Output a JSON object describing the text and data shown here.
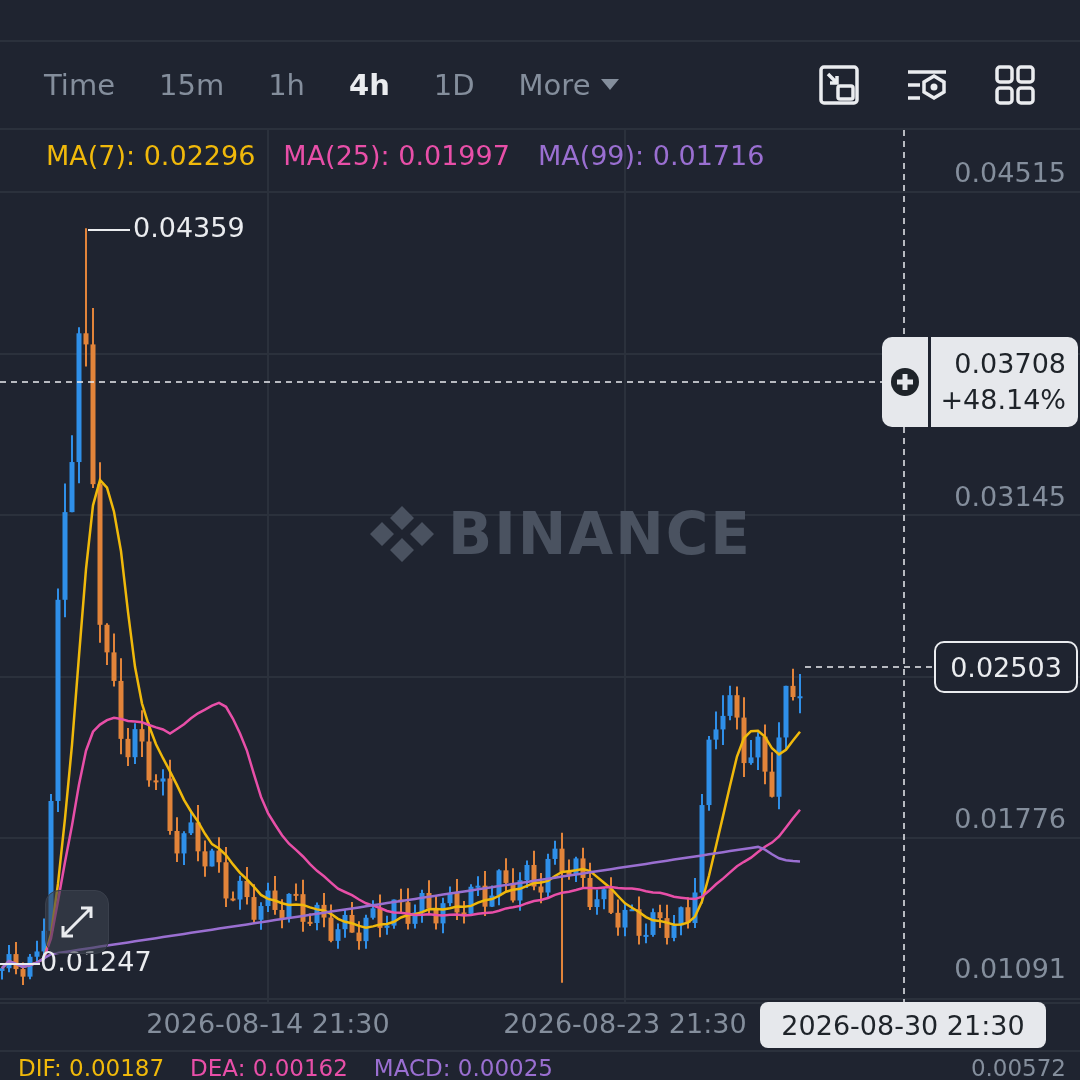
{
  "toolbar": {
    "intervals": [
      {
        "label": "Time",
        "selected": false
      },
      {
        "label": "15m",
        "selected": false
      },
      {
        "label": "1h",
        "selected": false
      },
      {
        "label": "4h",
        "selected": true
      },
      {
        "label": "1D",
        "selected": false
      }
    ],
    "more": "More"
  },
  "chart": {
    "legend": [
      {
        "label": "MA(7): 0.02296",
        "color": "#f0b90b"
      },
      {
        "label": "MA(25): 0.01997",
        "color": "#e84fa8"
      },
      {
        "label": "MA(99): 0.01716",
        "color": "#9a6fd1"
      }
    ],
    "watermark": "BINANCE",
    "price_axis": [
      "0.04515",
      "0.03145",
      "0.01776",
      "0.01091"
    ],
    "high_label": "0.04359",
    "low_label": "0.01247",
    "crosshair": {
      "price": "0.03708",
      "change": "+48.14%",
      "time": "2026-08-30 21:30"
    },
    "last_price": "0.02503",
    "time_axis": [
      "2026-08-14 21:30",
      "2026-08-23 21:30"
    ]
  },
  "macd": {
    "legend": [
      {
        "label": "DIF: 0.00187",
        "color": "#f0b90b"
      },
      {
        "label": "DEA: 0.00162",
        "color": "#e84fa8"
      },
      {
        "label": "MACD: 0.00025",
        "color": "#9a6fd1"
      }
    ],
    "axis": "0.00572"
  }
}
